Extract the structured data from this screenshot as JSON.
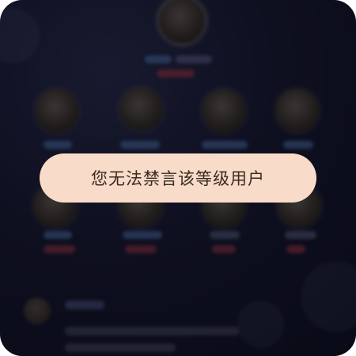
{
  "toast": {
    "message": "您无法禁言该等级用户"
  }
}
